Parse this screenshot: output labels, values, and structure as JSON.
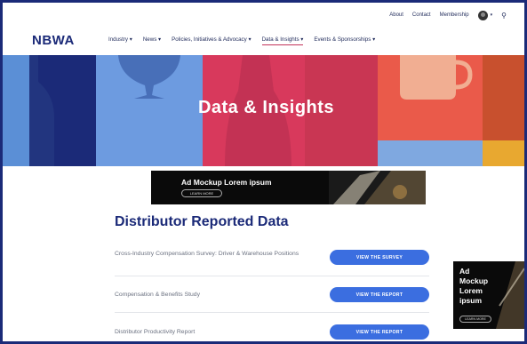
{
  "utility": {
    "links": [
      "About",
      "Contact",
      "Membership"
    ],
    "avatar_icon": "user-avatar-icon",
    "search_icon": "search-icon"
  },
  "header": {
    "logo": "NBWA",
    "nav": [
      {
        "label": "Industry ▾"
      },
      {
        "label": "News ▾"
      },
      {
        "label": "Policies, Initiatives & Advocacy ▾"
      },
      {
        "label": "Data & Insights ▾",
        "active": true
      },
      {
        "label": "Events & Sponsorships ▾"
      }
    ]
  },
  "hero": {
    "title": "Data & Insights",
    "colors": [
      "#5b8fd6",
      "#1b2a78",
      "#7fa8e0",
      "#d83a5c",
      "#e85b4b",
      "#f08a6a",
      "#e8a830"
    ]
  },
  "ads": {
    "banner": {
      "text": "Ad Mockup Lorem ipsum",
      "button": "LEARN MORE"
    },
    "side": {
      "text": "Ad Mockup Lorem ipsum",
      "button": "LEARN MORE"
    }
  },
  "main": {
    "title": "Distributor Reported Data",
    "rows": [
      {
        "label": "Cross-Industry Compensation Survey: Driver & Warehouse Positions",
        "button": "VIEW THE SURVEY"
      },
      {
        "label": "Compensation & Benefits Study",
        "button": "VIEW THE REPORT"
      },
      {
        "label": "Distributor Productivity Report",
        "button": "VIEW THE REPORT"
      }
    ]
  }
}
